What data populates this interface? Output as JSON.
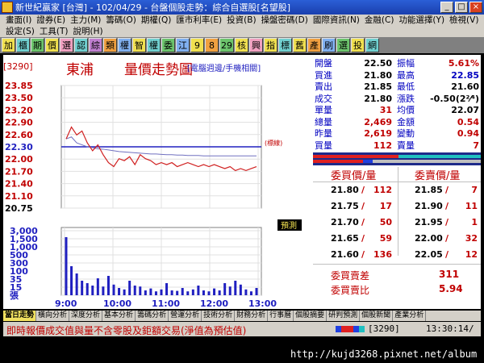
{
  "window": {
    "title": "新世紀贏家 [台灣] - 102/04/29 - 台盤個股走勢：綜合自選股[名望股]"
  },
  "menu": [
    "畫面(I)",
    "證券(E)",
    "主力(M)",
    "籌碼(O)",
    "期權(Q)",
    "匯市利率(E)",
    "投資(B)",
    "操盤密碼(D)",
    "國際資訊(N)",
    "金融(C)",
    "功能選擇(Y)",
    "檢視(V)",
    "設定(S)",
    "工具(T)",
    "說明(H)"
  ],
  "toolbar": [
    "加",
    "櫃",
    "期",
    "價",
    "選",
    "認",
    "綜",
    "類",
    "權",
    "智",
    "權",
    "委",
    "江",
    "9",
    "8",
    "29",
    "核",
    "興",
    "指",
    "標",
    "舊",
    "產",
    "刷",
    "選",
    "投",
    "網"
  ],
  "header": {
    "code": "[3290]",
    "name": "東浦",
    "title": "量價走勢圖",
    "note": "[電腦週邊/手機相關]"
  },
  "chart_data": {
    "type": "line",
    "x_ticks": [
      "9:00",
      "10:00",
      "11:00",
      "12:00",
      "13:00"
    ],
    "price_ticks": [
      "23.85",
      "23.50",
      "23.20",
      "22.90",
      "22.60",
      "22.30",
      "22.00",
      "21.70",
      "21.40",
      "21.10",
      "20.75"
    ],
    "volume_ticks": [
      "3,000",
      "1,500",
      "1,000",
      "500",
      "300",
      "100",
      "35",
      "15",
      "張"
    ],
    "reference_price": 22.3,
    "reference_label": "(標線)",
    "estimate_label": "預測",
    "price_range": [
      20.75,
      23.85
    ],
    "price": [
      22.5,
      22.8,
      22.6,
      22.7,
      22.4,
      22.2,
      22.35,
      22.1,
      21.9,
      21.8,
      22.0,
      21.95,
      22.05,
      21.85,
      22.1,
      22.0,
      21.95,
      21.85,
      21.9,
      21.85,
      21.9,
      21.8,
      21.85,
      21.9,
      21.85,
      21.8,
      21.85,
      21.8,
      21.85,
      21.8,
      21.75,
      21.8,
      21.7,
      21.75,
      21.7,
      21.75,
      21.8
    ],
    "avg": [
      22.5,
      22.55,
      22.4,
      22.35,
      22.3,
      22.28,
      22.25,
      22.24,
      22.22,
      22.2,
      22.18,
      22.17,
      22.16,
      22.15,
      22.14,
      22.13,
      22.12,
      22.12,
      22.11,
      22.1,
      22.1,
      22.09,
      22.09,
      22.08,
      22.08,
      22.08,
      22.07,
      22.07,
      22.07,
      22.07,
      22.07,
      22.07,
      22.07,
      22.07,
      22.07,
      22.07,
      22.07
    ],
    "volume": [
      120,
      60,
      45,
      30,
      25,
      20,
      35,
      18,
      40,
      22,
      15,
      12,
      30,
      20,
      18,
      10,
      14,
      8,
      12,
      25,
      10,
      9,
      15,
      8,
      12,
      20,
      10,
      8,
      14,
      10,
      25,
      18,
      30,
      22,
      12,
      8,
      15
    ]
  },
  "quote": {
    "left": [
      {
        "label": "開盤",
        "value": "22.50",
        "color": "#000000"
      },
      {
        "label": "買進",
        "value": "21.80",
        "color": "#000000"
      },
      {
        "label": "賣出",
        "value": "21.85",
        "color": "#000000"
      },
      {
        "label": "成交",
        "value": "21.80",
        "color": "#000000"
      },
      {
        "label": "單量",
        "value": "31",
        "color": "#c00000"
      },
      {
        "label": "總量",
        "value": "2,469",
        "color": "#c00000"
      },
      {
        "label": "昨量",
        "value": "2,619",
        "color": "#c00000"
      },
      {
        "label": "買量",
        "value": "112",
        "color": "#c00000"
      }
    ],
    "right": [
      {
        "label": "振幅",
        "value": "5.61%",
        "color": "#c00000"
      },
      {
        "label": "最高",
        "value": "22.85",
        "color": "#0000c0"
      },
      {
        "label": "最低",
        "value": "21.60",
        "color": "#000000"
      },
      {
        "label": "漲跌",
        "value": "-0.50(2²⁄⁴)",
        "color": "#000000"
      },
      {
        "label": "均價",
        "value": "22.07",
        "color": "#000000"
      },
      {
        "label": "金額",
        "value": "0.54",
        "color": "#c00000"
      },
      {
        "label": "變動",
        "value": "0.94",
        "color": "#c00000"
      },
      {
        "label": "賣量",
        "value": "7",
        "color": "#c00000"
      }
    ]
  },
  "orderbook": {
    "bid_header": "委買價/量",
    "ask_header": "委賣價/量",
    "bids": [
      {
        "price": "21.80",
        "qty": "112"
      },
      {
        "price": "21.75",
        "qty": "17"
      },
      {
        "price": "21.70",
        "qty": "50"
      },
      {
        "price": "21.65",
        "qty": "59"
      },
      {
        "price": "21.60",
        "qty": "136"
      }
    ],
    "asks": [
      {
        "price": "21.85",
        "qty": "7"
      },
      {
        "price": "21.90",
        "qty": "11"
      },
      {
        "price": "21.95",
        "qty": "1"
      },
      {
        "price": "22.00",
        "qty": "32"
      },
      {
        "price": "22.05",
        "qty": "12"
      }
    ],
    "diff_label": "委買賣差",
    "diff_value": "311",
    "ratio_label": "委買賣比",
    "ratio_value": "5.94"
  },
  "tabs": [
    "當日走勢",
    "橫向分析",
    "深度分析",
    "基本分析",
    "籌碼分析",
    "營運分析",
    "技術分析",
    "財務分析",
    "行事曆",
    "個股摘要",
    "研判預測",
    "個股新聞",
    "產業分析"
  ],
  "status": {
    "message": "即時報價成交值與量不含零股及鉅額交易(淨值為預估值)",
    "code": "3290",
    "time": "13:30:14/"
  },
  "watermark": "http://kujd3268.pixnet.net/album",
  "colors": {
    "accent_red": "#c00000",
    "accent_blue": "#0000c0",
    "price_line": "#d02020",
    "avg_line": "#7070c0",
    "volume_bar": "#2020c0"
  }
}
